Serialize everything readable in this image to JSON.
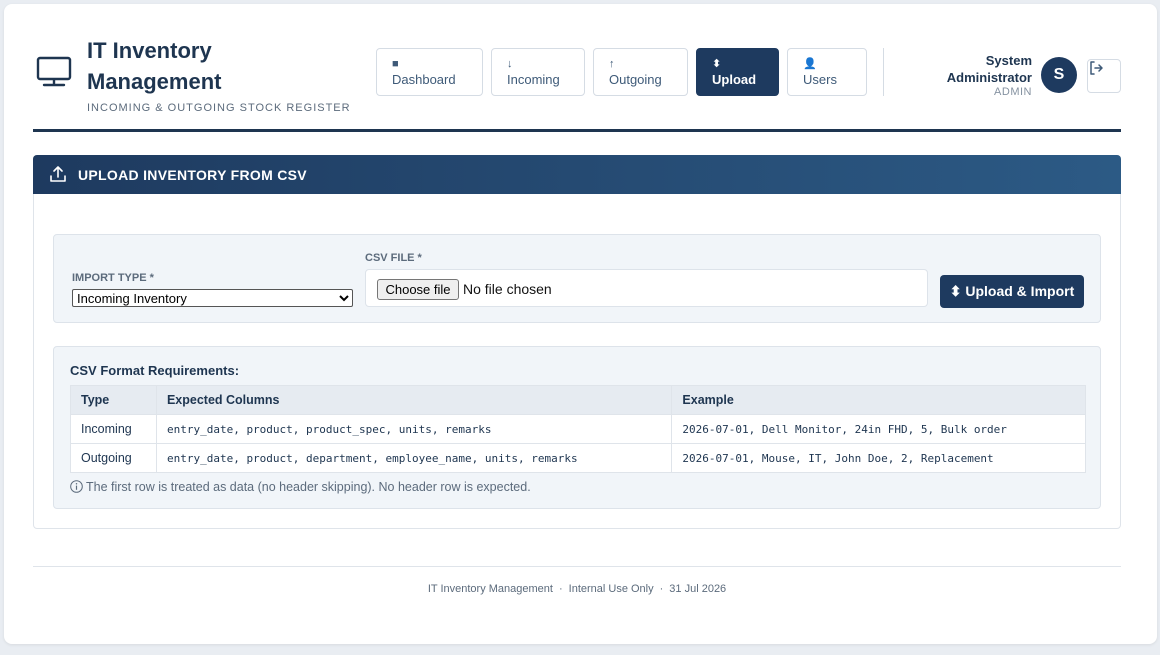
{
  "brand": {
    "icon": "monitor-icon",
    "title": "IT Inventory Management",
    "subtitle": "INCOMING & OUTGOING STOCK REGISTER"
  },
  "nav": [
    {
      "icon": "■",
      "label": "Dashboard"
    },
    {
      "icon": "↓",
      "label": "Incoming"
    },
    {
      "icon": "↑",
      "label": "Outgoing"
    },
    {
      "icon": "⬍",
      "label": "Upload"
    },
    {
      "icon": "👤",
      "label": "Users"
    }
  ],
  "active_nav": "Upload",
  "user": {
    "name": "System Administrator",
    "role": "ADMIN",
    "initial": "S"
  },
  "panel": {
    "icon": "upload-icon",
    "title": "UPLOAD INVENTORY FROM CSV"
  },
  "form": {
    "import_type_label": "IMPORT TYPE *",
    "import_type_value": "Incoming Inventory",
    "csv_file_label": "CSV FILE *",
    "choose_file_label": "Choose file",
    "file_status": "No file chosen",
    "upload_button": "⬍ Upload & Import"
  },
  "requirements": {
    "title": "CSV Format Requirements:",
    "columns": [
      "Type",
      "Expected Columns",
      "Example"
    ],
    "rows": [
      [
        "Incoming",
        "entry_date, product, product_spec, units, remarks",
        "2026-07-01, Dell Monitor, 24in FHD, 5, Bulk order"
      ],
      [
        "Outgoing",
        "entry_date, product, department, employee_name, units, remarks",
        "2026-07-01, Mouse, IT, John Doe, 2, Replacement"
      ]
    ],
    "note": "The first row is treated as data (no header skipping). No header row is expected."
  },
  "footer": {
    "app": "IT Inventory Management",
    "scope": "Internal Use Only",
    "date": "31 Jul 2026"
  },
  "colors": {
    "primary": "#1e3a5f",
    "text": "#1e3550",
    "muted": "#5c6b7c",
    "border": "#dfe4ea",
    "surface": "#f1f5f9"
  }
}
